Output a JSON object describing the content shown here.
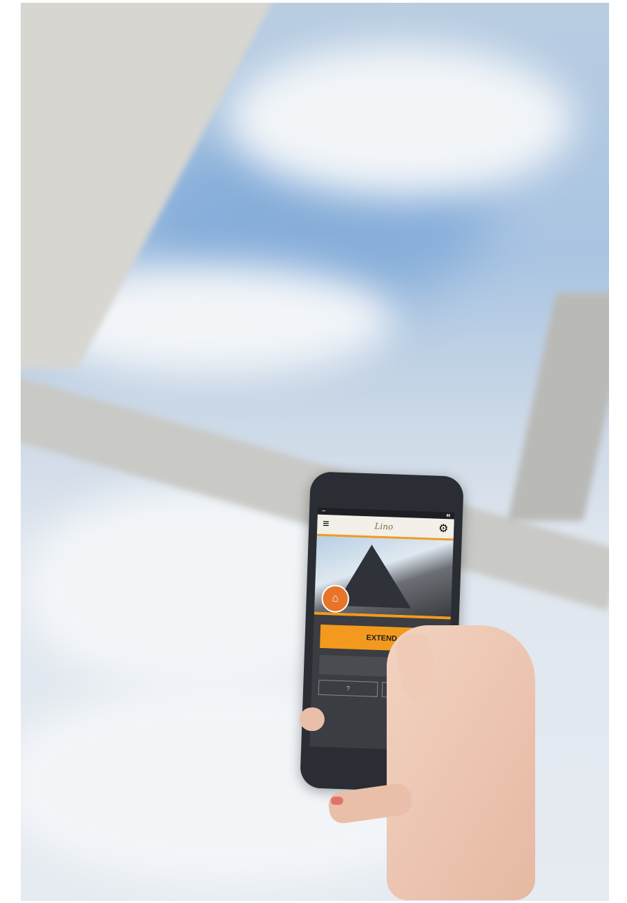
{
  "scene": {
    "description_label": "",
    "app": {
      "logo_text": "Lino",
      "primary_button_label": "EXTEND",
      "secondary_button_label": "",
      "menu_icon": "hamburger-icon",
      "settings_icon": "gear-icon",
      "badge_icon": "awning-icon"
    },
    "colors": {
      "accent": "#f39a1e",
      "badge": "#e8742a",
      "phone_body": "#2a2d33"
    }
  }
}
